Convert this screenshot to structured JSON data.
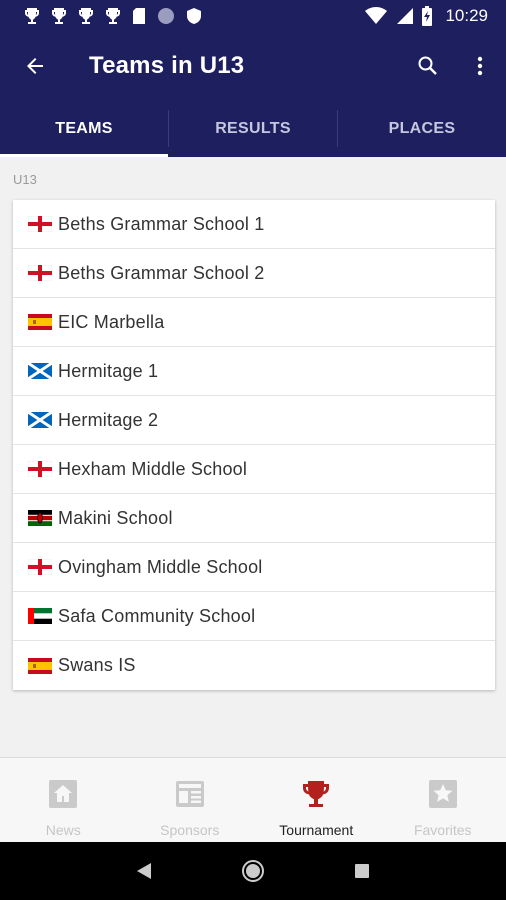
{
  "status_bar": {
    "time": "10:29",
    "left_icons": [
      "trophy-icon",
      "trophy-icon",
      "trophy-icon",
      "trophy-icon",
      "sim-card-icon",
      "circle-icon",
      "shield-icon"
    ],
    "right_icons": [
      "wifi-icon",
      "signal-icon",
      "battery-icon"
    ]
  },
  "header": {
    "title": "Teams in U13",
    "back_icon": "arrow-back-icon",
    "search_icon": "search-icon",
    "more_icon": "more-vert-icon",
    "background_color": "#1d1f5e"
  },
  "tabs": [
    {
      "label": "TEAMS",
      "active": true
    },
    {
      "label": "RESULTS",
      "active": false
    },
    {
      "label": "PLACES",
      "active": false
    }
  ],
  "section": {
    "label": "U13"
  },
  "teams": [
    {
      "name": "Beths Grammar School 1",
      "flag": "england-flag-icon"
    },
    {
      "name": "Beths Grammar School 2",
      "flag": "england-flag-icon"
    },
    {
      "name": "EIC Marbella",
      "flag": "spain-flag-icon"
    },
    {
      "name": "Hermitage 1",
      "flag": "scotland-flag-icon"
    },
    {
      "name": "Hermitage 2",
      "flag": "scotland-flag-icon"
    },
    {
      "name": "Hexham Middle School",
      "flag": "england-flag-icon"
    },
    {
      "name": "Makini School",
      "flag": "kenya-flag-icon"
    },
    {
      "name": "Ovingham Middle School",
      "flag": "england-flag-icon"
    },
    {
      "name": "Safa Community School",
      "flag": "uae-flag-icon"
    },
    {
      "name": "Swans IS",
      "flag": "spain-flag-icon"
    }
  ],
  "bottom_nav": [
    {
      "label": "News",
      "icon": "home-icon",
      "active": false
    },
    {
      "label": "Sponsors",
      "icon": "newspaper-icon",
      "active": false
    },
    {
      "label": "Tournament",
      "icon": "trophy-icon",
      "active": true
    },
    {
      "label": "Favorites",
      "icon": "star-icon",
      "active": false
    }
  ],
  "colors": {
    "accent": "#b3211e",
    "inactive_nav": "#c6c6c6"
  }
}
